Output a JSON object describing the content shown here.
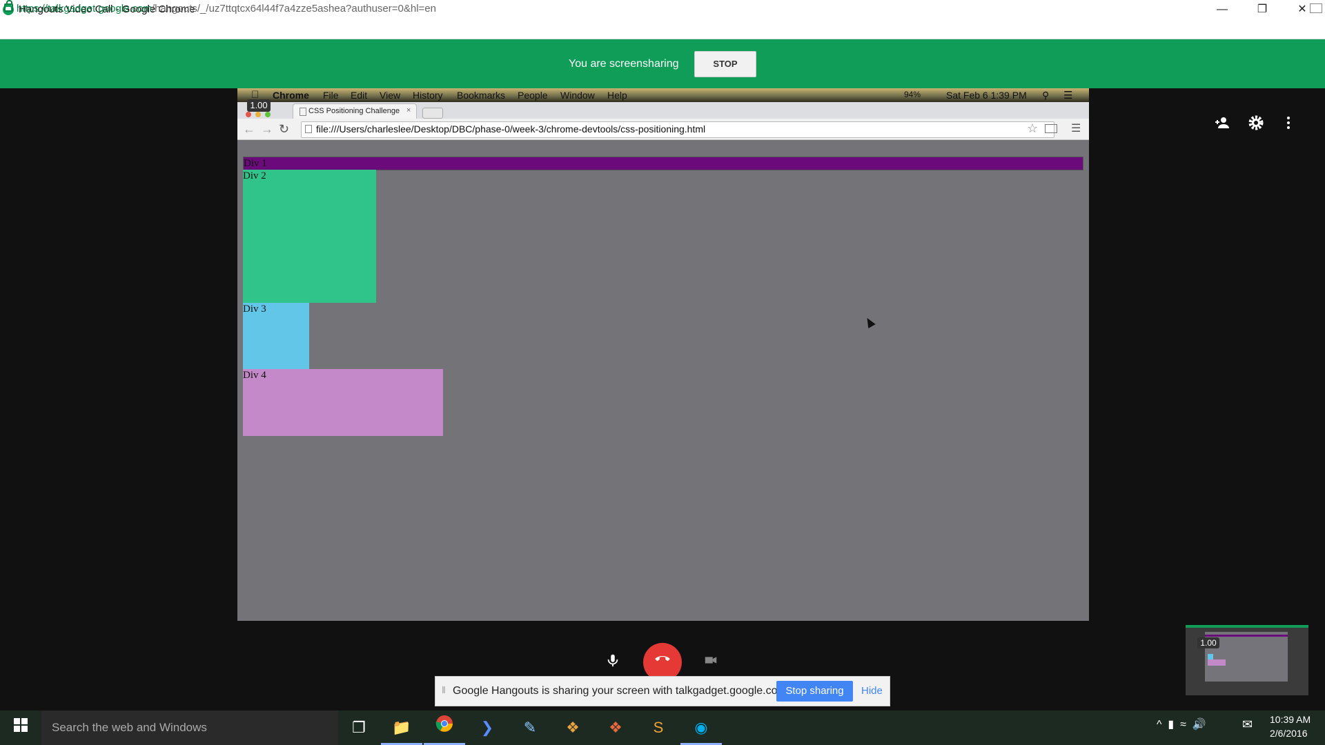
{
  "window": {
    "title": "Hangouts Video Call - Google Chrome",
    "controls": {
      "minimize": "—",
      "maximize": "❐",
      "close": "✕"
    }
  },
  "address_bar": {
    "url_host": "https://talkgadget.google.com",
    "url_path": "/hangouts/_/uz7ttqtcx64l44f7a4zze5ashea?authuser=0&hl=en"
  },
  "banner": {
    "text": "You are screensharing",
    "stop_label": "STOP",
    "color": "#0f9d58"
  },
  "side_icons": {
    "add_person": "add-person-icon",
    "settings": "gear-icon",
    "more": "more-vert-icon"
  },
  "shared_screen": {
    "mac_menu": [
      "Chrome",
      "File",
      "Edit",
      "View",
      "History",
      "Bookmarks",
      "People",
      "Window",
      "Help"
    ],
    "mac_status": {
      "battery": "94%",
      "datetime": "Sat Feb 6  1:39 PM"
    },
    "zoom": "1.00",
    "tab_title": "CSS Positioning Challenge",
    "tab_close": "×",
    "url": "file:///Users/charleslee/Desktop/DBC/phase-0/week-3/chrome-devtools/css-positioning.html",
    "divs": [
      "Div 1",
      "Div 2",
      "Div 3",
      "Div 4"
    ],
    "div_colors": [
      "#6b0a7a",
      "#30c48b",
      "#62c6e8",
      "#c389c8"
    ]
  },
  "call_controls": {
    "mic": "mic-icon",
    "hangup": "hangup-icon",
    "camera": "camera-off-icon"
  },
  "share_notification": {
    "text": "Google Hangouts is sharing your screen with talkgadget.google.com.",
    "stop_label": "Stop sharing",
    "hide_label": "Hide"
  },
  "preview": {
    "zoom": "1.00"
  },
  "taskbar": {
    "search_placeholder": "Search the web and Windows",
    "time": "10:39 AM",
    "date": "2/6/2016"
  }
}
